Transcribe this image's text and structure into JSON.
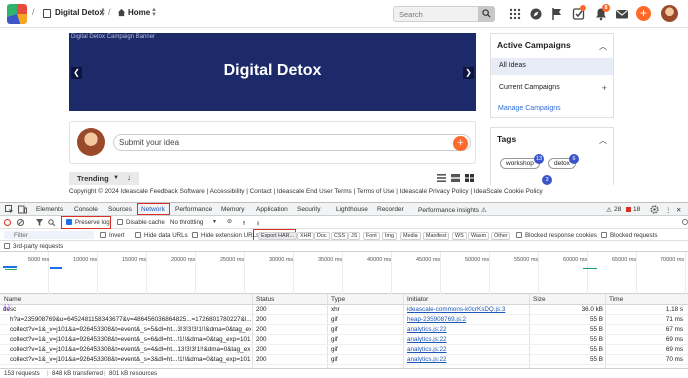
{
  "nav": {
    "workspace": "Digital Detox",
    "home": "Home",
    "search_placeholder": "Search",
    "notification_count": "8"
  },
  "hero": {
    "title": "Digital Detox",
    "alt_text": "Digital Detox Campaign Banner"
  },
  "idea": {
    "placeholder": "Submit your idea"
  },
  "sort": {
    "label": "Trending"
  },
  "campaigns": {
    "title": "Active Campaigns",
    "all_ideas": "All Ideas",
    "current": "Current Campaigns",
    "manage": "Manage Campaigns"
  },
  "tags": {
    "title": "Tags",
    "items": [
      {
        "name": "workshop",
        "count": "13"
      },
      {
        "name": "detox",
        "count": "6"
      },
      {
        "name": "",
        "count": "3"
      }
    ]
  },
  "footer": {
    "text": "Copyright © 2024 Ideascale Feedback Software | Accessibility | Contact | Ideascale End User Terms | Terms of Use | Ideascale Privacy Policy | IdeaScale Cookie Policy"
  },
  "devtools": {
    "tabs": [
      "Elements",
      "Console",
      "Sources",
      "Network",
      "Performance",
      "Memory",
      "Application",
      "Security",
      "Lighthouse",
      "Recorder",
      "Performance insights ⚠"
    ],
    "active_tab": "Network",
    "warnings": "28",
    "errors": "18",
    "toolbar": {
      "preserve_log": "Preserve log",
      "disable_cache": "Disable cache",
      "throttling": "No throttling",
      "export_har": "Export HAR..."
    },
    "filter": {
      "placeholder": "Filter",
      "invert": "Invert",
      "hide_data_urls": "Hide data URLs",
      "hide_extension_urls": "Hide extension URLs",
      "types": [
        "XHR",
        "Doc",
        "CSS",
        "JS",
        "Font",
        "Img",
        "Media",
        "Manifest",
        "WS",
        "Wasm",
        "Other"
      ],
      "blocked_response_cookies": "Blocked response cookies",
      "blocked_requests": "Blocked requests",
      "third_party": "3rd-party requests"
    },
    "timeline_ticks": [
      "5000 ms",
      "10000 ms",
      "15000 ms",
      "20000 ms",
      "25000 ms",
      "30000 ms",
      "35000 ms",
      "40000 ms",
      "45000 ms",
      "50000 ms",
      "55000 ms",
      "60000 ms",
      "65000 ms",
      "70000 ms"
    ],
    "columns": [
      "Name",
      "Status",
      "Type",
      "Initiator",
      "Size",
      "Time"
    ],
    "rows": [
      {
        "name": "desc",
        "status": "200",
        "type": "xhr",
        "initiator": "ideascale-commons-k0crKsDQ.js:3",
        "size": "36.0 kB",
        "time": "1.18 s"
      },
      {
        "name": "h?a=235908769&u=6452481158343677&v=486456036864825...=1726801780227&l...",
        "status": "200",
        "type": "gif",
        "initiator": "heap-235908769.js:2",
        "size": "55 B",
        "time": "71 ms"
      },
      {
        "name": "collect?v=1&_v=j101&a=926453308&t=event&_s=5&dl=ht...3!3!3!3!1!!&dma=0&tag_ex...",
        "status": "200",
        "type": "gif",
        "initiator": "analytics.js:22",
        "size": "55 B",
        "time": "67 ms"
      },
      {
        "name": "collect?v=1&_v=j101&a=926453308&t=event&_s=6&dl=ht...!1!!&dma=0&tag_exp=101...",
        "status": "200",
        "type": "gif",
        "initiator": "analytics.js:22",
        "size": "55 B",
        "time": "69 ms"
      },
      {
        "name": "collect?v=1&_v=j101&a=926453308&t=event&_s=4&dl=ht...13!3!3!1!!&dma=0&tag_ex...",
        "status": "200",
        "type": "gif",
        "initiator": "analytics.js:22",
        "size": "55 B",
        "time": "69 ms"
      },
      {
        "name": "collect?v=1&_v=j101&a=926453308&t=event&_s=3&dl=ht...!1!!&dma=0&tag_exp=101...",
        "status": "200",
        "type": "gif",
        "initiator": "analytics.js:22",
        "size": "55 B",
        "time": "70 ms"
      }
    ],
    "status": {
      "requests": "153 requests",
      "transferred": "848 kB transferred",
      "resources": "801 kB resources"
    }
  }
}
